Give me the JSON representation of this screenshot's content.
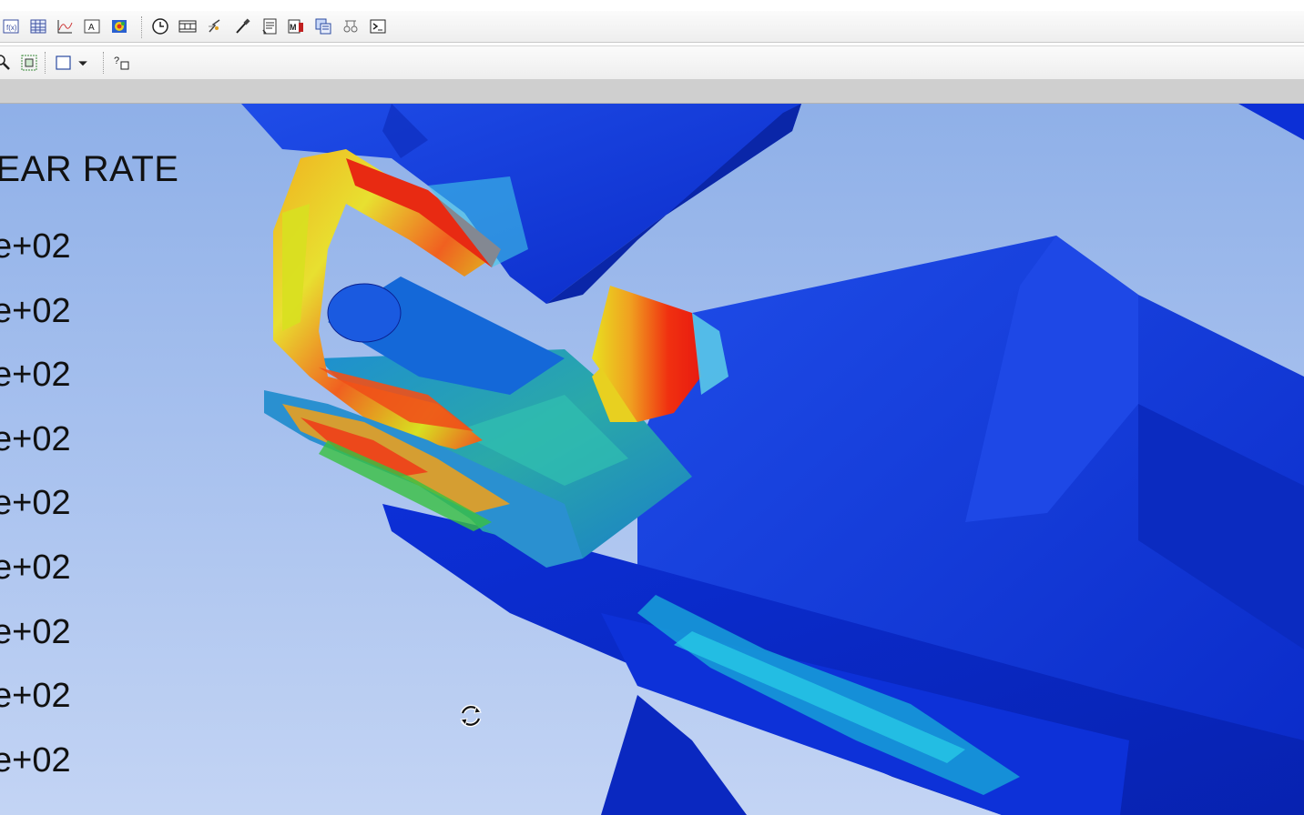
{
  "toolbar1": {
    "icons": [
      "calculator-icon",
      "table-icon",
      "xy-plot-icon",
      "annotate-text-icon",
      "contour-icon",
      "animation-clock-icon",
      "filmstrip-icon",
      "spark-icon",
      "probe-icon",
      "report-icon",
      "image-export-icon",
      "layers-icon",
      "scale-icon",
      "command-console-icon"
    ]
  },
  "toolbar2": {
    "icons": [
      "zoom-icon",
      "fit-view-icon",
      "viewport-layout-icon",
      "dropdown-arrow-icon",
      "help-pointer-icon"
    ]
  },
  "legend": {
    "title": "HEAR RATE",
    "values": [
      "e+02",
      "e+02",
      "e+02",
      "e+02",
      "e+02",
      "e+02",
      "e+02",
      "e+02",
      "e+02"
    ]
  },
  "colors": {
    "background_top": "#8fb0e8",
    "background_bottom": "#c3d4f4",
    "contour_min": "#0a2ee0",
    "contour_low": "#1aa0e0",
    "contour_mid": "#2ab0a0",
    "contour_high_mid": "#d8e020",
    "contour_max": "#f02010"
  },
  "cursor": "rotate-cursor-icon"
}
